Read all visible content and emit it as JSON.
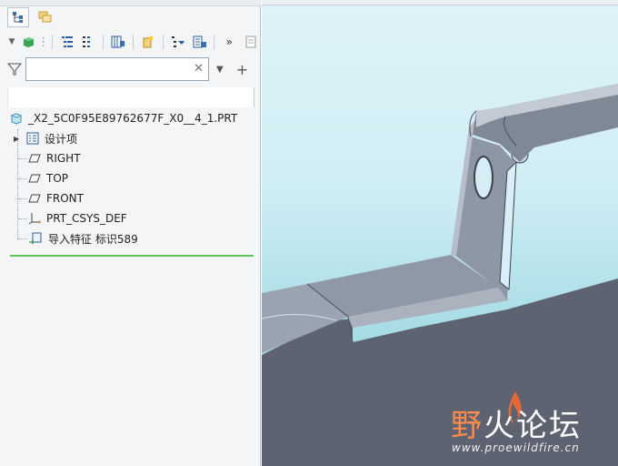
{
  "model_tree": {
    "root_label": "_X2_5C0F95E89762677F_X0__4_1.PRT",
    "items": [
      {
        "label": "设计项",
        "icon": "design-items-icon",
        "expandable": true
      },
      {
        "label": "RIGHT",
        "icon": "datum-plane-icon"
      },
      {
        "label": "TOP",
        "icon": "datum-plane-icon"
      },
      {
        "label": "FRONT",
        "icon": "datum-plane-icon"
      },
      {
        "label": "PRT_CSYS_DEF",
        "icon": "coordinate-system-icon"
      },
      {
        "label": "导入特征 标识589",
        "icon": "import-feature-icon"
      }
    ]
  },
  "search": {
    "value": "",
    "placeholder": ""
  },
  "watermark": {
    "brand_first": "野",
    "brand_rest": "火论坛",
    "url": "www.proewildfire.cn"
  },
  "colors": {
    "tree_end_line": "#5fc45a",
    "part_face": "#5e6470",
    "part_top": "#8d96a3",
    "viewport_bg": "#bfe6ee"
  }
}
